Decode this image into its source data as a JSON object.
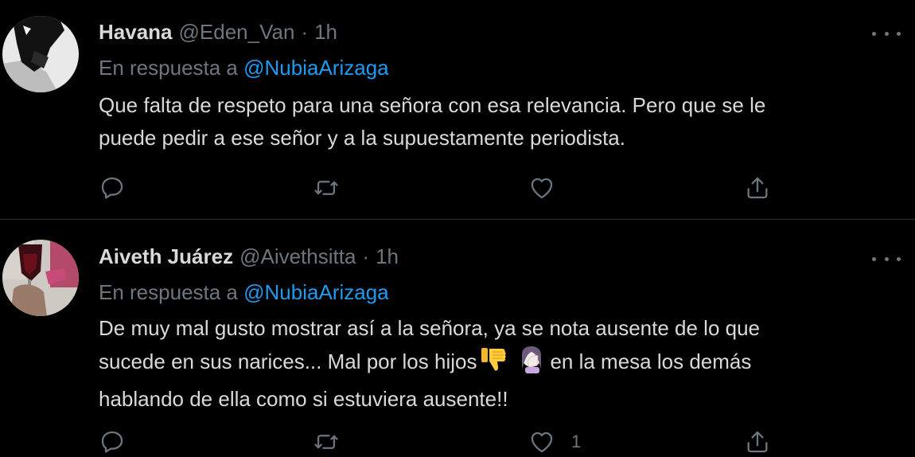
{
  "tweets": [
    {
      "name": "Havana",
      "handle": "@Eden_Van",
      "separator": "·",
      "time": "1h",
      "reply_prefix": "En respuesta a",
      "reply_to": "@NubiaArizaga",
      "text_lines": [
        "Que falta de respeto para una señora con esa relevancia. Pero que se le",
        "puede pedir a ese señor y a la supuestamente periodista."
      ],
      "like_count": ""
    },
    {
      "name": "Aiveth Juárez",
      "handle": "@Aivethsitta",
      "separator": "·",
      "time": "1h",
      "reply_prefix": "En respuesta a",
      "reply_to": "@NubiaArizaga",
      "text_lines": [
        "De muy mal gusto mostrar así a la señora, ya se nota ausente de lo que",
        "sucede en sus narices... Mal por los hijos",
        "en la mesa los demás",
        "hablando de ella como si estuviera ausente!!"
      ],
      "emojis": [
        "thumbs-down-emoji",
        "facepalm-emoji"
      ],
      "like_count": "1"
    }
  ],
  "icons": {
    "reply": "comment-icon",
    "retweet": "retweet-icon",
    "like": "heart-icon",
    "share": "share-icon",
    "more": "more-icon"
  },
  "colors": {
    "background": "#000000",
    "text": "#d9d9d9",
    "muted": "#6e767d",
    "link": "#1d9bf0",
    "divider": "#2f3336"
  }
}
